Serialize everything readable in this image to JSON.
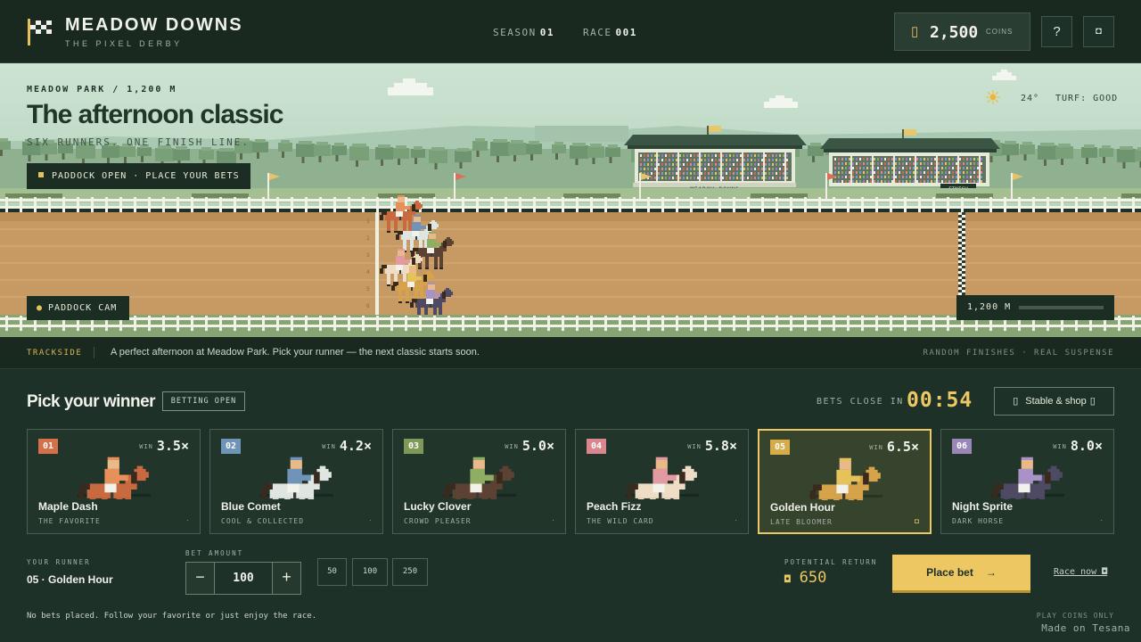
{
  "header": {
    "brand_title": "MEADOW DOWNS",
    "brand_subtitle": "THE PIXEL DERBY",
    "season_label": "SEASON",
    "season_value": "01",
    "race_label": "RACE",
    "race_value": "001",
    "coins_value": "2,500",
    "coins_unit": "COINS",
    "help_label": "?",
    "settings_label": "◘"
  },
  "scene": {
    "location": "MEADOW PARK / 1,200 M",
    "title": "The afternoon classic",
    "subtitle": "SIX RUNNERS. ONE FINISH LINE.",
    "status": "PADDOCK OPEN · PLACE YOUR BETS",
    "temperature": "24°",
    "turf": "TURF: GOOD",
    "camera": "PADDOCK CAM",
    "distance": "1,200 M",
    "finish_sign": "FINISH",
    "stand_sign": "MEADOW DOWNS",
    "lane_numbers": [
      "1",
      "2",
      "3",
      "4",
      "5",
      "6"
    ]
  },
  "ticker": {
    "label": "TRACKSIDE",
    "message": "A perfect afternoon at Meadow Park. Pick your runner — the next classic starts soon.",
    "right": "RANDOM FINISHES · REAL SUSPENSE"
  },
  "betting": {
    "title": "Pick your winner",
    "badge": "BETTING OPEN",
    "closes_label": "BETS CLOSE IN",
    "timer": "00:54",
    "stable_label": "Stable & shop",
    "win_label": "WIN",
    "horses": [
      {
        "num": "01",
        "name": "Maple Dash",
        "tag": "THE FAVORITE",
        "odds": "3.5×",
        "color": "#c8693f",
        "num_bg": "#d4714a",
        "silk": "#e8905a",
        "mark": "·"
      },
      {
        "num": "02",
        "name": "Blue Comet",
        "tag": "COOL & COLLECTED",
        "odds": "4.2×",
        "color": "#dfe5e0",
        "num_bg": "#6f94b8",
        "silk": "#6f94b8",
        "mark": "·"
      },
      {
        "num": "03",
        "name": "Lucky Clover",
        "tag": "CROWD PLEASER",
        "odds": "5.0×",
        "color": "#5c4232",
        "num_bg": "#7e9a57",
        "silk": "#8fae63",
        "mark": "·"
      },
      {
        "num": "04",
        "name": "Peach Fizz",
        "tag": "THE WILD CARD",
        "odds": "5.8×",
        "color": "#efdcc4",
        "num_bg": "#d9868e",
        "silk": "#e39aa0",
        "mark": "·"
      },
      {
        "num": "05",
        "name": "Golden Hour",
        "tag": "LATE BLOOMER",
        "odds": "6.5×",
        "color": "#d6a24a",
        "num_bg": "#d6ac4a",
        "silk": "#e6c25a",
        "mark": "◘"
      },
      {
        "num": "06",
        "name": "Night Sprite",
        "tag": "DARK HORSE",
        "odds": "8.0×",
        "color": "#4e4a63",
        "num_bg": "#9b86b8",
        "silk": "#a892c6",
        "mark": "·"
      }
    ],
    "selected_index": 4
  },
  "slip": {
    "runner_label": "YOUR RUNNER",
    "runner_value": "05 · Golden Hour",
    "amount_label": "BET AMOUNT",
    "amount": "100",
    "minus": "−",
    "plus": "+",
    "chips": [
      "50",
      "100",
      "250"
    ],
    "return_label": "POTENTIAL RETURN",
    "return_value": "650",
    "place_label": "Place bet",
    "race_now": "Race now ◘",
    "note": "No bets placed. Follow your favorite or just enjoy the race.",
    "play_only": "PLAY COINS ONLY",
    "made_on": "Made on Tesana"
  },
  "colors": {
    "accent": "#ecc762",
    "background": "#1e3129",
    "track": "#c79a64"
  },
  "icons": {
    "logo": "checkered-flag-icon",
    "coins": "coin-icon",
    "weather": "sun-icon"
  }
}
